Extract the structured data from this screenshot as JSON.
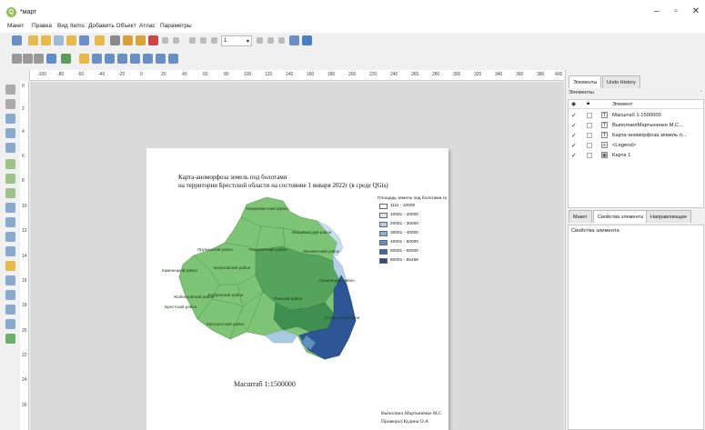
{
  "window": {
    "title": "*март",
    "min_glyph": "–",
    "max_glyph": "▫",
    "close_glyph": "✕",
    "app_glyph": "Q"
  },
  "menu": [
    "Макет",
    "Правка",
    "Вид",
    "Items",
    "Добавить Объект",
    "Атлас",
    "Параметры"
  ],
  "toolbar": {
    "zoom_value": "1"
  },
  "ruler": {
    "top_ticks": [
      "-100",
      "-80",
      "-60",
      "-40",
      "-20",
      "0",
      "20",
      "40",
      "60",
      "80",
      "100",
      "120",
      "140",
      "160",
      "180",
      "200",
      "220",
      "240",
      "260",
      "280",
      "300",
      "320",
      "340",
      "360",
      "380",
      "400"
    ],
    "left_ticks": [
      "0",
      "2",
      "4",
      "6",
      "8",
      "10",
      "12",
      "14",
      "16",
      "18",
      "20",
      "22",
      "24",
      "26"
    ]
  },
  "map_page": {
    "title_line1": "Карта-аноморфоза земель под болотами",
    "title_line2": "на территории Брестской области на состояние 1 января 2022г (в среде QGis)",
    "legend_title": "Площадь земель под болотами,га",
    "legend": [
      {
        "label": "1111 - 10000",
        "color": "#f5f9fd"
      },
      {
        "label": "10001 - 20000",
        "color": "#dbe8f4"
      },
      {
        "label": "20001 - 30000",
        "color": "#b5cfe8"
      },
      {
        "label": "30001 - 40000",
        "color": "#8cb3d6"
      },
      {
        "label": "40001 - 50000",
        "color": "#5f91c0"
      },
      {
        "label": "50001 - 60000",
        "color": "#3c6aa4"
      },
      {
        "label": "60001 - 65498",
        "color": "#2b4d8a"
      }
    ],
    "districts": [
      "Барановичский район",
      "Ивацевичский район",
      "Ляховичский район",
      "Пружанский район",
      "Ганцевичский район",
      "Каменецкий район",
      "Березовский район",
      "Дрогичинский район",
      "Лунинецкий район",
      "Жабинковский район",
      "Кобринский район",
      "Пинский район",
      "Брестский район",
      "Столинский район",
      "Малоритский район"
    ],
    "scale": "Масштаб 1:1500000",
    "author_line1": "Выполнил:Мартыненко М.С",
    "author_line2": "Проверил:Кудина О.А"
  },
  "panel": {
    "top_tabs": [
      "Элементы",
      "Undo History"
    ],
    "items_section": "Элементы",
    "items_header": "Элемент",
    "items": [
      {
        "name": "Масштаб 1:1500000",
        "icon": "T",
        "checked": "✓"
      },
      {
        "name": "ВыполнилМартыненко М.С...",
        "icon": "T",
        "checked": "✓"
      },
      {
        "name": "Карта-аноморфоза земель п...",
        "icon": "T",
        "checked": "✓"
      },
      {
        "name": "<Legend>",
        "icon": "≡",
        "checked": "✓"
      },
      {
        "name": "Карта 1",
        "icon": "▦",
        "checked": "✓"
      }
    ],
    "bottom_tabs": [
      "Макет",
      "Свойства элемента",
      "Направляющие"
    ],
    "props_label": "Свойства элемента"
  }
}
